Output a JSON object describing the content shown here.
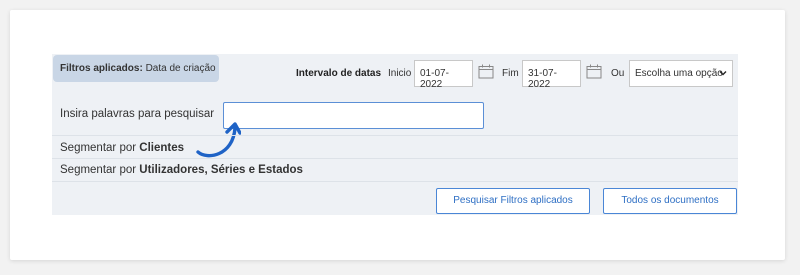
{
  "filters": {
    "applied_label": "Filtros aplicados:",
    "applied_value": "Data de criação"
  },
  "date_range": {
    "label": "Intervalo de datas",
    "start_label": "Inicio",
    "start_value": "01-07-2022",
    "end_label": "Fim",
    "end_value": "31-07-2022",
    "or_label": "Ou",
    "select_value": "Escolha uma opção"
  },
  "search": {
    "label": "Insira palavras para pesquisar",
    "value": ""
  },
  "segments": {
    "prefix": "Segmentar por",
    "clients": "Clientes",
    "users": "Utilizadores, Séries e Estados"
  },
  "buttons": {
    "search_filters": "Pesquisar Filtros aplicados",
    "all_documents": "Todos os documentos"
  },
  "colors": {
    "accent": "#2e6fc4",
    "arrow": "#1f63c6",
    "panel": "#eef1f5",
    "badge": "#c9d6e6"
  },
  "icons": [
    "calendar-icon",
    "chevron-down-icon",
    "curved-arrow-icon"
  ]
}
